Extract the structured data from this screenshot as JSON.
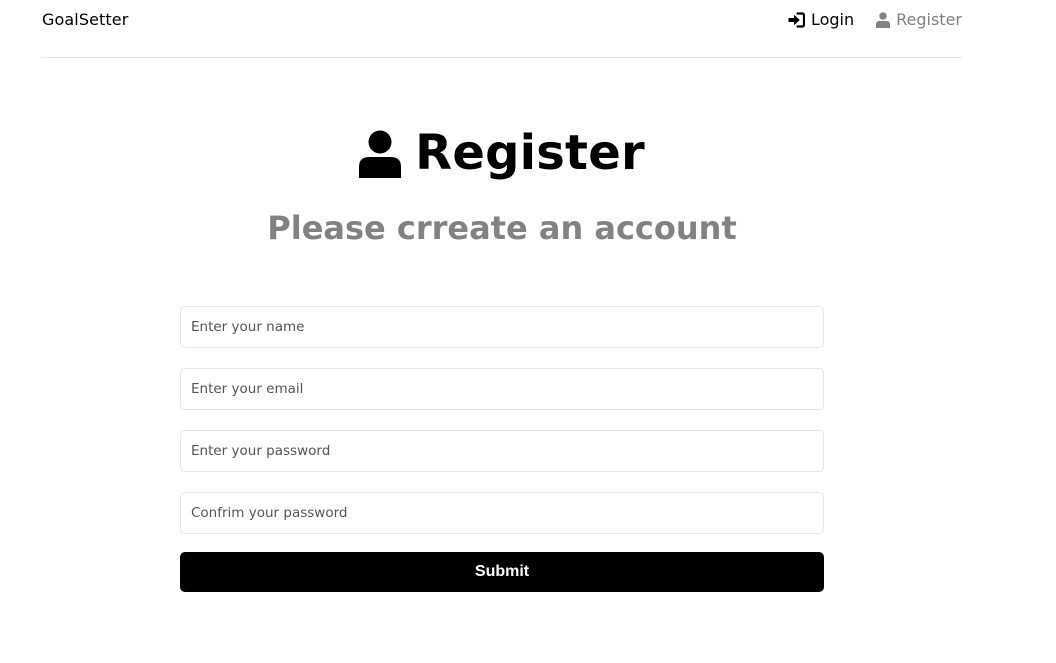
{
  "header": {
    "logo": "GoalSetter",
    "nav": {
      "login": {
        "label": "Login",
        "icon": "sign-in-icon"
      },
      "register": {
        "label": "Register",
        "icon": "user-icon"
      }
    }
  },
  "heading": {
    "title": "Register",
    "icon": "user-icon",
    "subtitle": "Please crreate an account"
  },
  "form": {
    "name_placeholder": "Enter your name",
    "email_placeholder": "Enter your email",
    "password_placeholder": "Enter your password",
    "confirm_placeholder": "Confrim your password",
    "submit_label": "Submit"
  },
  "colors": {
    "primary": "#000000",
    "muted": "#828282",
    "border": "#e6e6e6",
    "background": "#ffffff"
  }
}
